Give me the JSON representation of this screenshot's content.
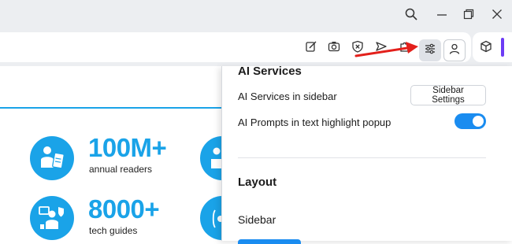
{
  "window": {
    "controls": [
      "search-icon",
      "minimize-icon",
      "restore-icon",
      "close-icon"
    ]
  },
  "toolbar": {
    "icons": [
      "edit-icon",
      "camera-icon",
      "shield-icon",
      "send-icon",
      "extensions-icon",
      "sidebar-settings-icon",
      "profile-icon",
      "cube-icon"
    ]
  },
  "stats": [
    {
      "number": "100M+",
      "label": "annual readers"
    },
    {
      "number": "8000+",
      "label": "tech guides"
    }
  ],
  "menu": {
    "ai_services_heading": "AI Services",
    "ai_services_in_sidebar_label": "AI Services in sidebar",
    "sidebar_settings_button": "Sidebar Settings",
    "ai_prompts_label": "AI Prompts in text highlight popup",
    "ai_prompts_enabled": true,
    "layout_heading": "Layout",
    "sidebar_label": "Sidebar"
  },
  "colors": {
    "accent_blue": "#1aa3e8",
    "toggle_blue": "#1a8cf0",
    "arrow_red": "#e3201b",
    "profile_accent": "#6d3cf5"
  }
}
